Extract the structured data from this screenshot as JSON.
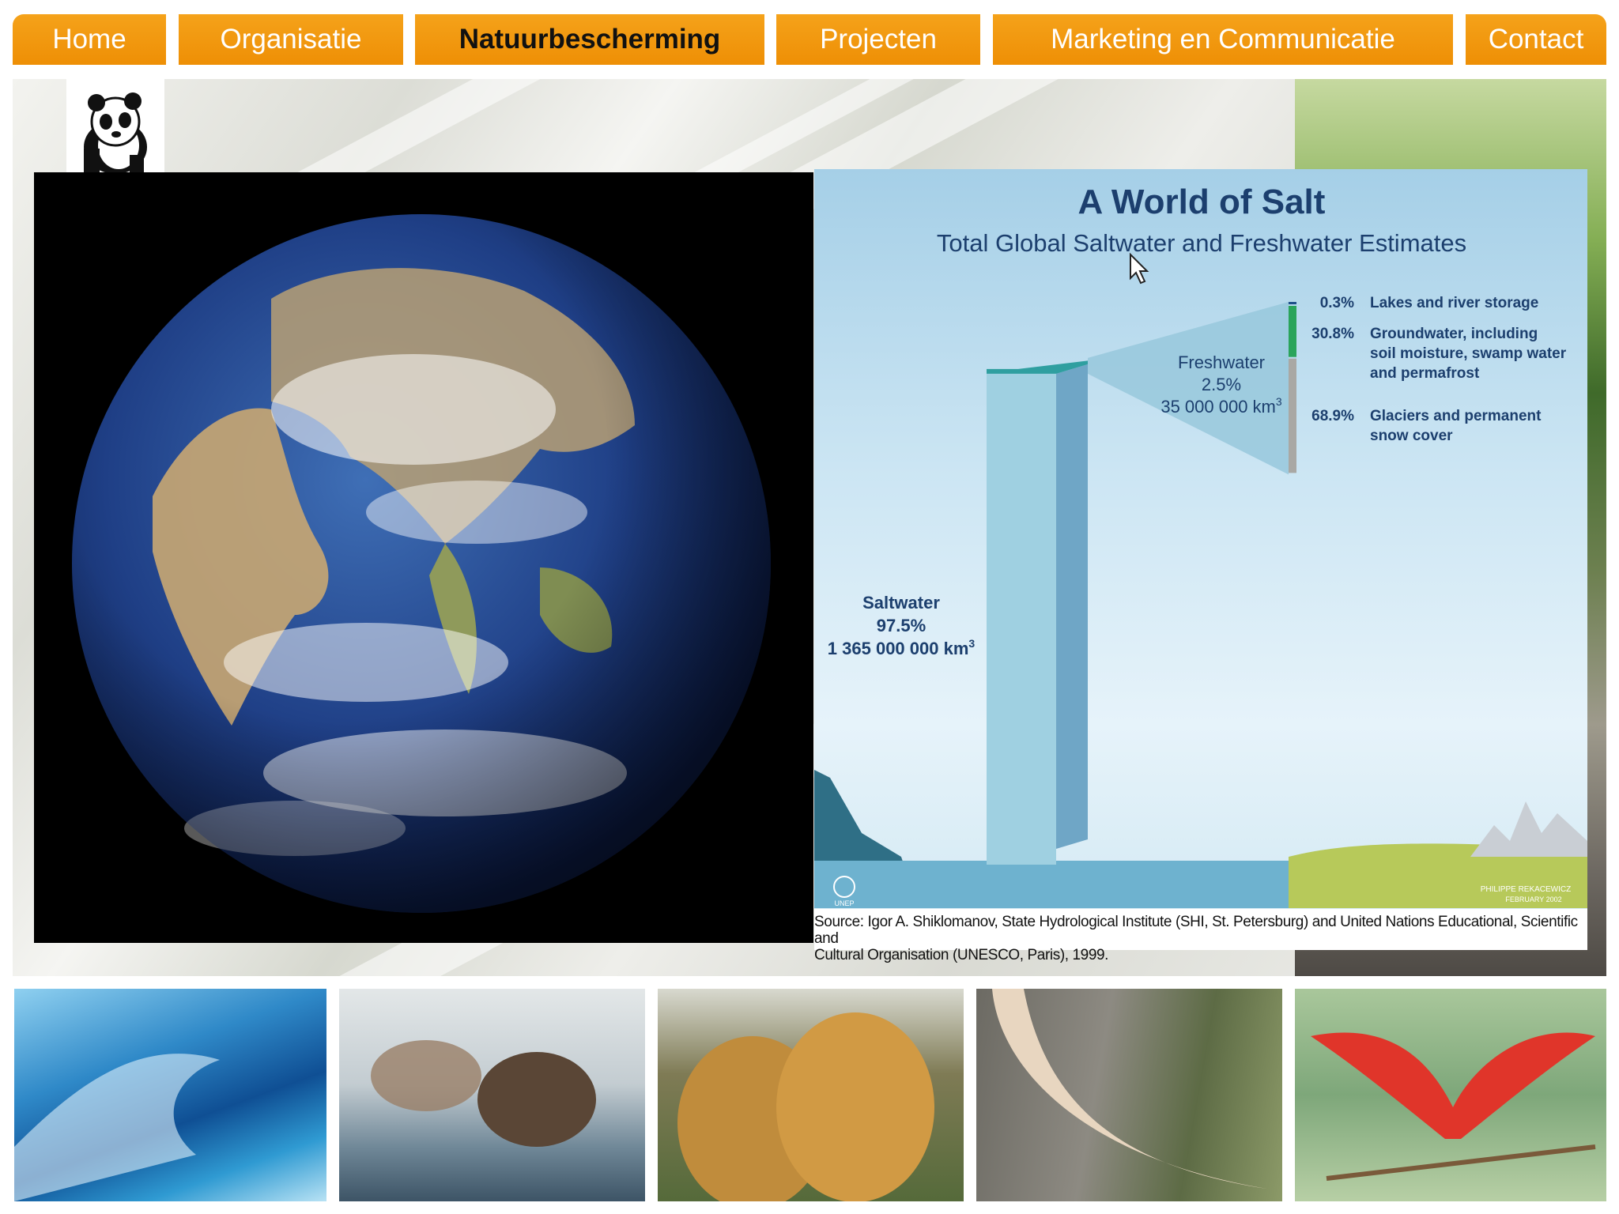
{
  "nav": {
    "items": [
      {
        "label": "Home"
      },
      {
        "label": "Organisatie"
      },
      {
        "label": "Natuurbescherming"
      },
      {
        "label": "Projecten"
      },
      {
        "label": "Marketing en Communicatie"
      },
      {
        "label": "Contact"
      }
    ],
    "active": "Natuurbescherming",
    "accent_color": "#f39a0c"
  },
  "logo": {
    "icon": "panda-icon"
  },
  "slide": {
    "title": "A World of Salt",
    "subtitle": "Total Global Saltwater and Freshwater Estimates",
    "saltwater": {
      "label": "Saltwater",
      "percent": "97.5%",
      "volume": "1 365 000 000 km",
      "unit_sup": "3"
    },
    "freshwater": {
      "label": "Freshwater",
      "percent": "2.5%",
      "volume": "35 000 000 km",
      "unit_sup": "3"
    },
    "breakdown": [
      {
        "percent": "0.3%",
        "line1": "Lakes and river storage",
        "line2": "",
        "line3": ""
      },
      {
        "percent": "30.8%",
        "line1": "Groundwater, including",
        "line2": "soil moisture, swamp water",
        "line3": "and permafrost"
      },
      {
        "percent": "68.9%",
        "line1": "Glaciers and permanent",
        "line2": "snow cover",
        "line3": ""
      }
    ],
    "credit_line1": "PHILIPPE REKACEWICZ",
    "credit_line2": "FEBRUARY 2002",
    "unep": "UNEP",
    "source_line1": "Source: Igor A. Shiklomanov, State Hydrological Institute (SHI, St. Petersburg) and United Nations Educational, Scientific and",
    "source_line2": "Cultural Organisation (UNESCO, Paris), 1999."
  },
  "chart_data": {
    "type": "bar",
    "title": "A World of Salt",
    "subtitle": "Total Global Saltwater and Freshwater Estimates",
    "categories": [
      "Saltwater",
      "Freshwater"
    ],
    "values": [
      97.5,
      2.5
    ],
    "volumes_km3": [
      1365000000,
      35000000
    ],
    "freshwater_breakdown": {
      "categories": [
        "Lakes and river storage",
        "Groundwater, including soil moisture, swamp water and permafrost",
        "Glaciers and permanent snow cover"
      ],
      "values": [
        0.3,
        30.8,
        68.9
      ]
    }
  },
  "gallery": [
    {
      "name": "wave-photo"
    },
    {
      "name": "bears-photo"
    },
    {
      "name": "jaguars-photo"
    },
    {
      "name": "elephant-tusk-photo"
    },
    {
      "name": "scarlet-ibis-photo"
    }
  ]
}
